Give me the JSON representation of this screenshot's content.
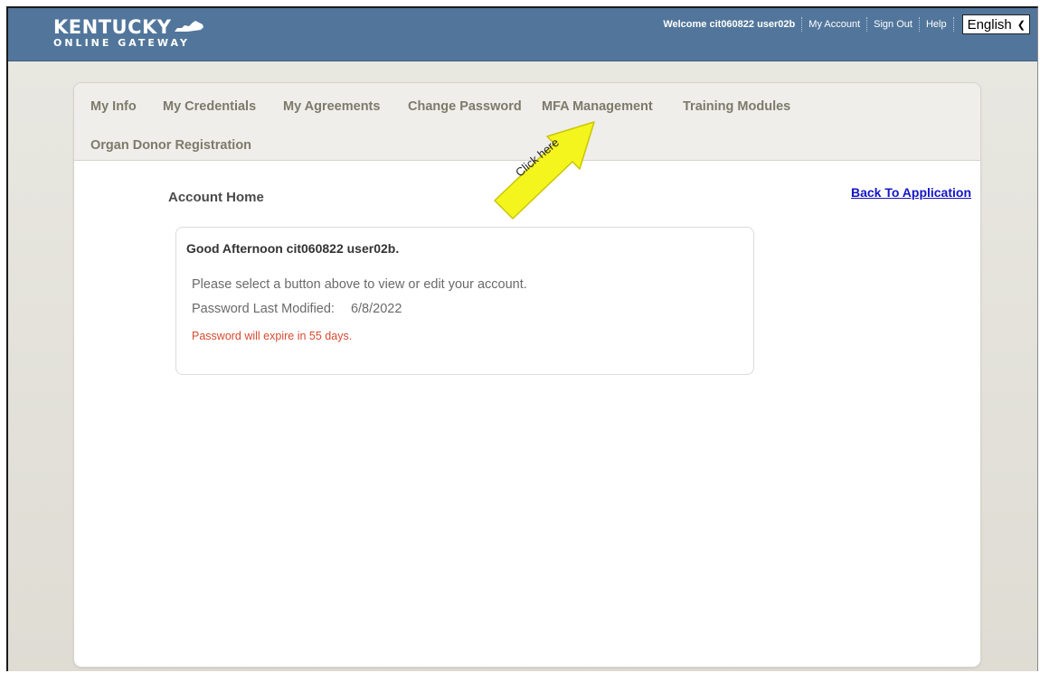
{
  "brand": {
    "name": "KENTUCKY",
    "subtitle": "ONLINE GATEWAY"
  },
  "header": {
    "welcome": "Welcome cit060822 user02b",
    "my_account": "My Account",
    "sign_out": "Sign Out",
    "help": "Help",
    "language": "English"
  },
  "tabs": [
    {
      "label": "My Info"
    },
    {
      "label": "My Credentials"
    },
    {
      "label": "My Agreements"
    },
    {
      "label": "Change Password"
    },
    {
      "label": "MFA Management"
    },
    {
      "label": "Training Modules"
    },
    {
      "label": "Organ Donor Registration"
    }
  ],
  "main": {
    "title": "Account Home",
    "back_link": "Back To Application",
    "greeting": "Good Afternoon cit060822 user02b.",
    "instruction": "Please select a button above to view or edit your account.",
    "password_label": "Password Last Modified:",
    "password_value": "6/8/2022",
    "expire_notice": "Password will expire in 55 days."
  },
  "callout": {
    "text": "Click here",
    "color": "#f5f51e"
  },
  "colors": {
    "header_bg": "#52769b",
    "link": "#1414c8",
    "warning": "#d84a2e"
  }
}
